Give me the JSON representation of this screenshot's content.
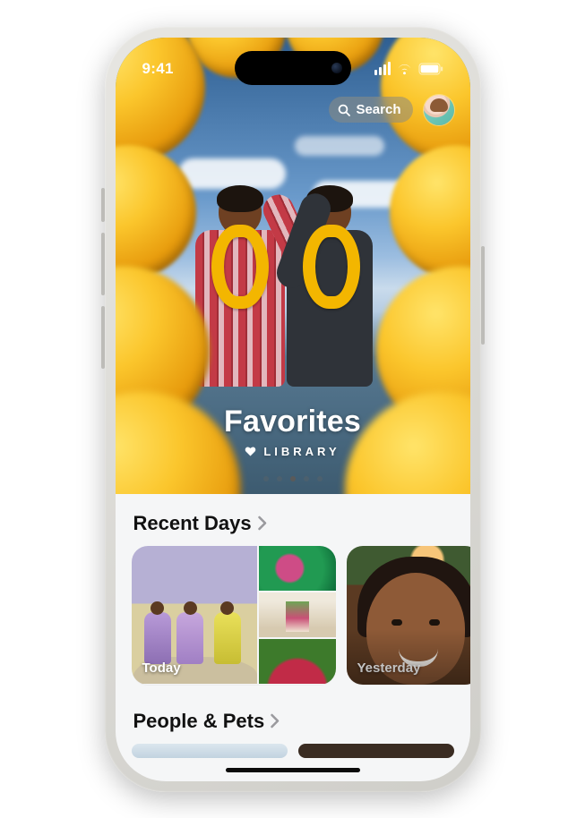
{
  "status_bar": {
    "time": "9:41"
  },
  "top": {
    "search_label": "Search"
  },
  "hero": {
    "title": "Favorites",
    "subtitle": "LIBRARY",
    "pager": {
      "count": 5,
      "active_index": 2
    }
  },
  "sections": {
    "recent_days": {
      "title": "Recent Days",
      "cards": [
        {
          "label": "Today"
        },
        {
          "label": "Yesterday"
        }
      ]
    },
    "people_pets": {
      "title": "People & Pets"
    }
  }
}
